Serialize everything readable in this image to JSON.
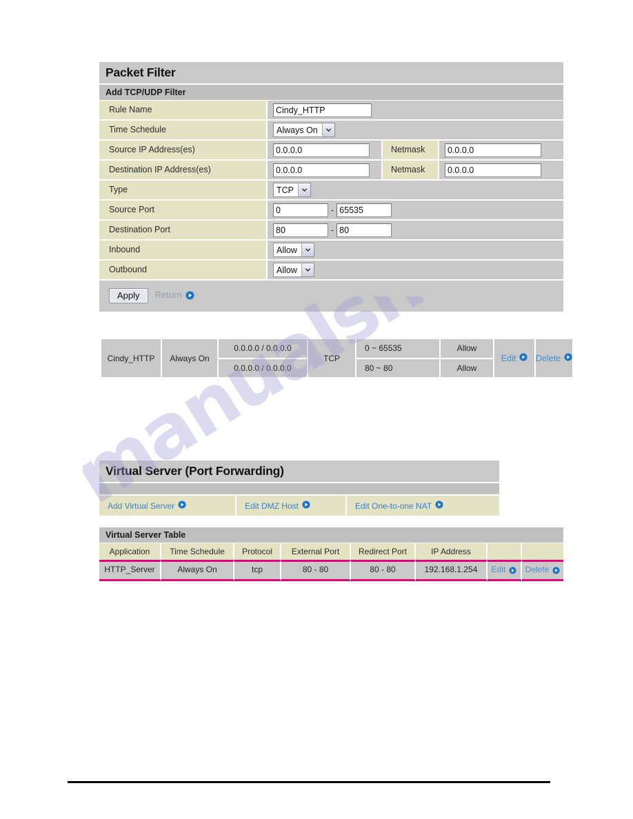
{
  "packet_filter": {
    "title": "Packet Filter",
    "subhead": "Add TCP/UDP Filter",
    "rows": {
      "rule_name": {
        "label": "Rule Name",
        "value": "Cindy_HTTP"
      },
      "time_schedule": {
        "label": "Time Schedule",
        "value": "Always On"
      },
      "source_ip": {
        "label": "Source IP Address(es)",
        "value": "0.0.0.0",
        "netmask_label": "Netmask",
        "netmask_value": "0.0.0.0"
      },
      "destination_ip": {
        "label": "Destination IP Address(es)",
        "value": "0.0.0.0",
        "netmask_label": "Netmask",
        "netmask_value": "0.0.0.0"
      },
      "type": {
        "label": "Type",
        "value": "TCP"
      },
      "source_port": {
        "label": "Source Port",
        "from": "0",
        "to": "65535",
        "separator": "-"
      },
      "destination_port": {
        "label": "Destination Port",
        "from": "80",
        "to": "80",
        "separator": "-"
      },
      "inbound": {
        "label": "Inbound",
        "value": "Allow"
      },
      "outbound": {
        "label": "Outbound",
        "value": "Allow"
      }
    },
    "actions": {
      "apply_label": "Apply",
      "return_label": "Return"
    }
  },
  "filter_table": {
    "rule_name": "Cindy_HTTP",
    "time_schedule": "Always On",
    "source_ip": "0.0.0.0 / 0.0.0.0",
    "destination_ip": "0.0.0.0 / 0.0.0.0",
    "type": "TCP",
    "source_port": "0 ~ 65535",
    "destination_port": "80 ~ 80",
    "inbound": "Allow",
    "outbound": "Allow",
    "edit_label": "Edit",
    "delete_label": "Delete"
  },
  "virtual_server": {
    "title": "Virtual Server (Port Forwarding)",
    "links": [
      {
        "label": "Add Virtual Server"
      },
      {
        "label": "Edit DMZ Host"
      },
      {
        "label": "Edit One-to-one NAT"
      }
    ],
    "table": {
      "caption": "Virtual Server Table",
      "headers": [
        "Application",
        "Time Schedule",
        "Protocol",
        "External Port",
        "Redirect Port",
        "IP Address",
        "",
        ""
      ],
      "rows": [
        {
          "application": "HTTP_Server",
          "time_schedule": "Always On",
          "protocol": "tcp",
          "external_port": "80 - 80",
          "redirect_port": "80 - 80",
          "ip_address": "192.168.1.254",
          "edit_label": "Edit",
          "delete_label": "Delete"
        }
      ]
    }
  },
  "watermark": {
    "text": "manualshive.com"
  },
  "colors": {
    "panel_gray": "#c9c9c9",
    "label_khaki": "#e3e3c3",
    "link_blue": "#3a7fc4",
    "row_highlight_pink": "#e6007e"
  }
}
